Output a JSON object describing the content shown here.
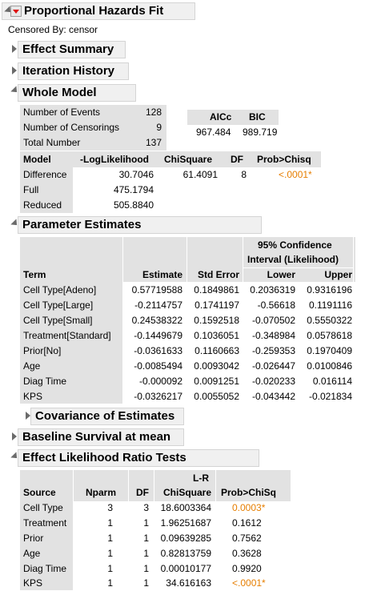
{
  "report": {
    "title": "Proportional Hazards Fit",
    "censored_by": "Censored By: censor"
  },
  "sections": {
    "effect_summary": "Effect Summary",
    "iteration_history": "Iteration History",
    "whole_model": "Whole Model",
    "parameter_estimates": "Parameter Estimates",
    "covariance": "Covariance of Estimates",
    "baseline": "Baseline Survival at mean",
    "lr_tests": "Effect Likelihood Ratio Tests"
  },
  "whole_model": {
    "counts": [
      {
        "label": "Number of Events",
        "value": "128"
      },
      {
        "label": "Number of Censorings",
        "value": "9"
      },
      {
        "label": "Total Number",
        "value": "137"
      }
    ],
    "ic_headers": [
      "AICc",
      "BIC"
    ],
    "ic_values": [
      "967.484",
      "989.719"
    ],
    "model_headers": [
      "Model",
      "-LogLikelihood",
      "ChiSquare",
      "DF",
      "Prob>Chisq"
    ],
    "model_rows": [
      {
        "model": "Difference",
        "loglik": "30.7046",
        "chisq": "61.4091",
        "df": "8",
        "prob": "<.0001*"
      },
      {
        "model": "Full",
        "loglik": "475.1794",
        "chisq": "",
        "df": "",
        "prob": ""
      },
      {
        "model": "Reduced",
        "loglik": "505.8840",
        "chisq": "",
        "df": "",
        "prob": ""
      }
    ]
  },
  "parameter_estimates": {
    "ci_header_line1": "95% Confidence",
    "ci_header_line2": "Interval (Likelihood)",
    "headers": [
      "Term",
      "Estimate",
      "Std Error",
      "Lower",
      "Upper"
    ],
    "rows": [
      {
        "term": "Cell Type[Adeno]",
        "est": "0.57719588",
        "se": "0.1849861",
        "lower": "0.2036319",
        "upper": "0.9316196"
      },
      {
        "term": "Cell Type[Large]",
        "est": "-0.2114757",
        "se": "0.1741197",
        "lower": "-0.56618",
        "upper": "0.1191116"
      },
      {
        "term": "Cell Type[Small]",
        "est": "0.24538322",
        "se": "0.1592518",
        "lower": "-0.070502",
        "upper": "0.5550322"
      },
      {
        "term": "Treatment[Standard]",
        "est": "-0.1449679",
        "se": "0.1036051",
        "lower": "-0.348984",
        "upper": "0.0578618"
      },
      {
        "term": "Prior[No]",
        "est": "-0.0361633",
        "se": "0.1160663",
        "lower": "-0.259353",
        "upper": "0.1970409"
      },
      {
        "term": "Age",
        "est": "-0.0085494",
        "se": "0.0093042",
        "lower": "-0.026447",
        "upper": "0.0100846"
      },
      {
        "term": "Diag Time",
        "est": "-0.000092",
        "se": "0.0091251",
        "lower": "-0.020233",
        "upper": "0.016114"
      },
      {
        "term": "KPS",
        "est": "-0.0326217",
        "se": "0.0055052",
        "lower": "-0.043442",
        "upper": "-0.021834"
      }
    ]
  },
  "lr_tests": {
    "chisq_header_line1": "L-R",
    "headers": [
      "Source",
      "Nparm",
      "DF",
      "ChiSquare",
      "Prob>ChiSq"
    ],
    "rows": [
      {
        "source": "Cell Type",
        "nparm": "3",
        "df": "3",
        "chisq": "18.6003364",
        "prob": "0.0003*",
        "sig": true
      },
      {
        "source": "Treatment",
        "nparm": "1",
        "df": "1",
        "chisq": "1.96251687",
        "prob": "0.1612",
        "sig": false
      },
      {
        "source": "Prior",
        "nparm": "1",
        "df": "1",
        "chisq": "0.09639285",
        "prob": "0.7562",
        "sig": false
      },
      {
        "source": "Age",
        "nparm": "1",
        "df": "1",
        "chisq": "0.82813759",
        "prob": "0.3628",
        "sig": false
      },
      {
        "source": "Diag Time",
        "nparm": "1",
        "df": "1",
        "chisq": "0.00010177",
        "prob": "0.9920",
        "sig": false
      },
      {
        "source": "KPS",
        "nparm": "1",
        "df": "1",
        "chisq": "34.616163",
        "prob": "<.0001*",
        "sig": true
      }
    ]
  },
  "colors": {
    "significant": "#e67e00",
    "header_bg": "#f0f0f0",
    "table_shade": "#e2e2e2",
    "menu_red": "#dd1111"
  },
  "icons": [
    "red-triangle-menu-icon",
    "disclosure-right-icon",
    "disclosure-down-icon"
  ]
}
